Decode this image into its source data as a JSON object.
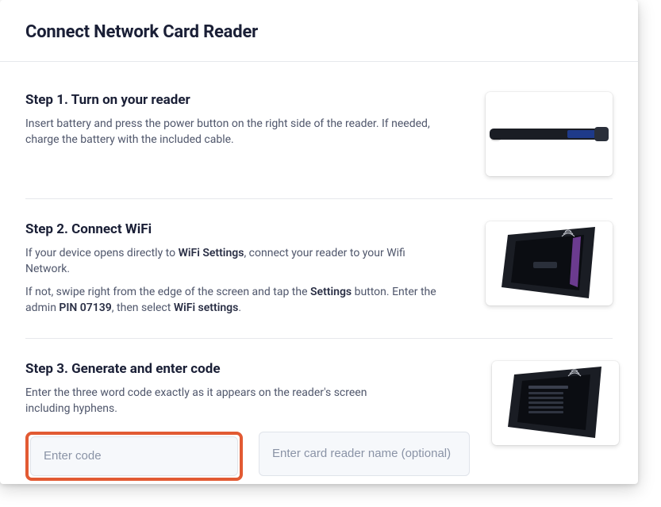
{
  "header": {
    "title": "Connect Network Card Reader"
  },
  "steps": {
    "s1": {
      "heading": "Step 1. Turn on your reader",
      "desc": "Insert battery and press the power button on the right side of the reader. If needed, charge the battery with the included cable."
    },
    "s2": {
      "heading": "Step 2. Connect WiFi",
      "p1_a": "If your device opens directly to ",
      "p1_b": "WiFi Settings",
      "p1_c": ", connect your reader to your Wifi Network.",
      "p2_a": "If not, swipe right from the edge of the screen and tap the ",
      "p2_b": "Settings",
      "p2_c": " button. Enter the admin ",
      "p2_d": "PIN 07139",
      "p2_e": ", then select ",
      "p2_f": "WiFi settings",
      "p2_g": "."
    },
    "s3": {
      "heading": "Step 3. Generate and enter code",
      "desc": "Enter the three word code exactly as it appears on the reader's screen including hyphens.",
      "code_placeholder": "Enter code",
      "name_placeholder": "Enter card reader name (optional)"
    }
  }
}
